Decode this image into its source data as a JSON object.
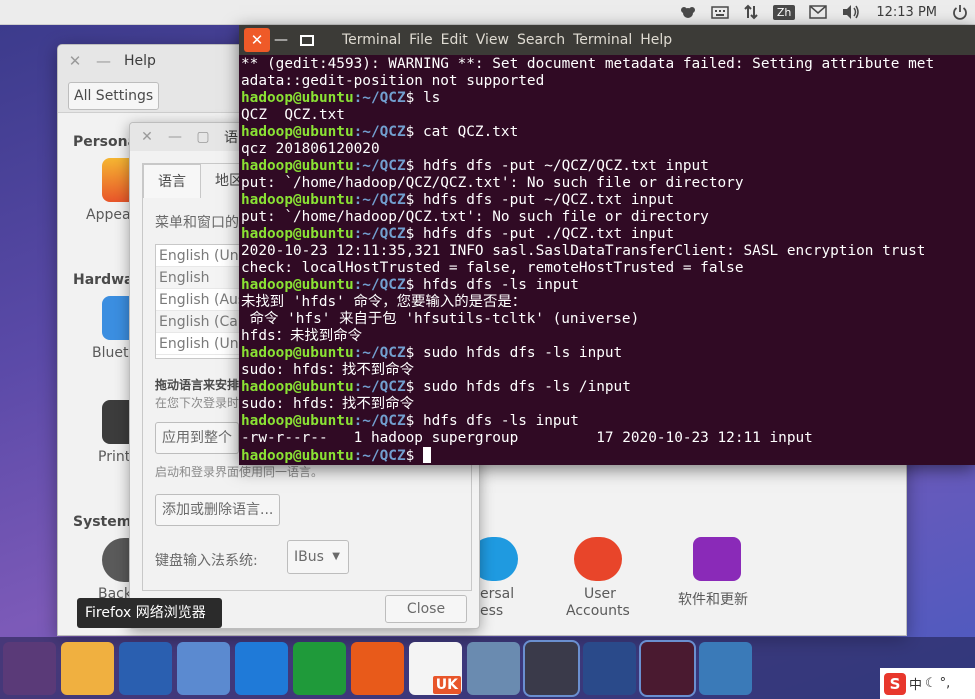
{
  "top_panel": {
    "input_method": "Zh",
    "time": "12:13 PM",
    "icons": [
      "network-icon",
      "keyboard-icon",
      "transfer-icon",
      "input-zh-icon",
      "mail-icon",
      "volume-icon",
      "power-icon"
    ]
  },
  "settings_window": {
    "title": "Help",
    "all_settings_label": "All Settings",
    "sections": {
      "personal": "Personal",
      "hardware": "Hardware",
      "system": "System"
    },
    "items": {
      "appearance": "Appea",
      "bluetooth": "Bluet",
      "printers": "Print",
      "backups": "Back",
      "universal": "ersal",
      "universal_2": "ess",
      "user_accounts": "User",
      "user_accounts_2": "Accounts",
      "software_updates": "软件和更新"
    },
    "close_label": "Close"
  },
  "language_dialog": {
    "title": "语",
    "tabs": [
      "语言",
      "地区"
    ],
    "menu_heading": "菜单和窗口的",
    "languages": [
      "English (Uni",
      "English",
      "English (Aus",
      "English (Car",
      "English (Uni"
    ],
    "drag_hint": "拖动语言来安排",
    "drag_sub": "在您下次登录时",
    "apply_button": "应用到整个",
    "apply_sub": "启动和登录界面使用同一语言。",
    "add_remove_button": "添加或删除语言...",
    "ime_label": "键盘输入法系统:",
    "ime_value": "IBus"
  },
  "terminal": {
    "menu": [
      "Terminal",
      "File",
      "Edit",
      "View",
      "Search",
      "Terminal",
      "Help"
    ],
    "user": "hadoop@ubuntu",
    "path": ":~/QCZ",
    "lines": [
      {
        "type": "out",
        "text": "** (gedit:4593): WARNING **: Set document metadata failed: Setting attribute met"
      },
      {
        "type": "out",
        "text": "adata::gedit-position not supported"
      },
      {
        "type": "cmd",
        "cmd": "ls"
      },
      {
        "type": "out",
        "text": "QCZ  QCZ.txt"
      },
      {
        "type": "cmd",
        "cmd": "cat QCZ.txt"
      },
      {
        "type": "out",
        "text": "qcz 201806120020"
      },
      {
        "type": "cmd",
        "cmd": "hdfs dfs -put ~/QCZ/QCZ.txt input"
      },
      {
        "type": "out",
        "text": "put: `/home/hadoop/QCZ/QCZ.txt': No such file or directory"
      },
      {
        "type": "cmd",
        "cmd": "hdfs dfs -put ~/QCZ.txt input"
      },
      {
        "type": "out",
        "text": "put: `/home/hadoop/QCZ.txt': No such file or directory"
      },
      {
        "type": "cmd",
        "cmd": "hdfs dfs -put ./QCZ.txt input"
      },
      {
        "type": "out",
        "text": "2020-10-23 12:11:35,321 INFO sasl.SaslDataTransferClient: SASL encryption trust"
      },
      {
        "type": "out",
        "text": "check: localHostTrusted = false, remoteHostTrusted = false"
      },
      {
        "type": "cmd",
        "cmd": "hfds dfs -ls input"
      },
      {
        "type": "out",
        "text": "未找到 'hfds' 命令，您要输入的是否是："
      },
      {
        "type": "out",
        "text": " 命令 'hfs' 来自于包 'hfsutils-tcltk' (universe)"
      },
      {
        "type": "out",
        "text": "hfds：未找到命令"
      },
      {
        "type": "cmd",
        "cmd": "sudo hfds dfs -ls input"
      },
      {
        "type": "out",
        "text": "sudo: hfds：找不到命令"
      },
      {
        "type": "cmd",
        "cmd": "sudo hfds dfs -ls /input"
      },
      {
        "type": "out",
        "text": "sudo: hfds：找不到命令"
      },
      {
        "type": "cmd",
        "cmd": "hdfs dfs -ls input"
      },
      {
        "type": "out",
        "text": "-rw-r--r--   1 hadoop supergroup         17 2020-10-23 12:11 input"
      },
      {
        "type": "cursor"
      }
    ]
  },
  "launcher": {
    "tooltip": "Firefox 网络浏览器",
    "items": [
      {
        "name": "ubuntu-dash-icon",
        "color": "#5a3a78"
      },
      {
        "name": "files-icon",
        "color": "#f0b040"
      },
      {
        "name": "firefox-icon",
        "color": "#2a5fb0"
      },
      {
        "name": "chromium-icon",
        "color": "#5b8ad0"
      },
      {
        "name": "wps-writer-icon",
        "color": "#1f7ad8"
      },
      {
        "name": "wps-spreadsheet-icon",
        "color": "#1f9a3a"
      },
      {
        "name": "wps-presentation-icon",
        "color": "#e85a1a"
      },
      {
        "name": "software-center-icon",
        "color": "#f4f4f4"
      },
      {
        "name": "robot-app-icon",
        "color": "#6a8bb0"
      },
      {
        "name": "terminal-icon",
        "color": "#3a3a4a"
      },
      {
        "name": "folder-app-icon",
        "color": "#2a4a8a"
      },
      {
        "name": "screen-record-icon",
        "color": "#4a1a30"
      },
      {
        "name": "globe-icon",
        "color": "#3a7ab8"
      }
    ],
    "uk_badge": "UK"
  },
  "tray": {
    "sogou": "S",
    "lang": "中"
  }
}
